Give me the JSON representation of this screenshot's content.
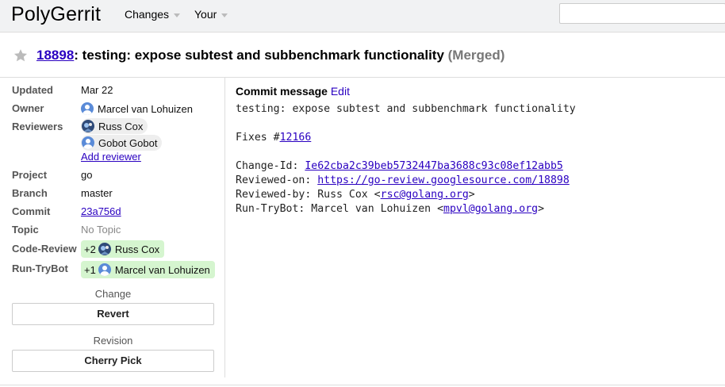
{
  "header": {
    "brand": "PolyGerrit",
    "nav": [
      "Changes",
      "Your"
    ],
    "search": {
      "value": "",
      "placeholder": ""
    }
  },
  "change": {
    "number": "18898",
    "title": ": testing: expose subtest and subbenchmark functionality ",
    "status": "(Merged)"
  },
  "info": {
    "updated_label": "Updated",
    "updated": "Mar 22",
    "owner_label": "Owner",
    "owner": "Marcel van Lohuizen",
    "reviewers_label": "Reviewers",
    "reviewer1": "Russ Cox",
    "reviewer2": "Gobot Gobot",
    "add_reviewer": "Add reviewer",
    "project_label": "Project",
    "project": "go",
    "branch_label": "Branch",
    "branch": "master",
    "commit_label": "Commit",
    "commit": "23a756d",
    "topic_label": "Topic",
    "topic": "No Topic",
    "code_review_label": "Code-Review",
    "code_review_vote": "+2",
    "code_review_user": "Russ Cox",
    "run_trybot_label": "Run-TryBot",
    "run_trybot_vote": "+1",
    "run_trybot_user": "Marcel van Lohuizen"
  },
  "actions": {
    "change_title": "Change",
    "revert": "Revert",
    "revision_title": "Revision",
    "cherry_pick": "Cherry Pick"
  },
  "commit_message": {
    "heading": "Commit message",
    "edit": "Edit",
    "subject": "testing: expose subtest and subbenchmark functionality",
    "fixes_prefix": "Fixes #",
    "fixes_num": "12166",
    "change_id_prefix": "Change-Id: ",
    "change_id": "Ie62cba2c39beb5732447ba3688c93c08ef12abb5",
    "reviewed_on_prefix": "Reviewed-on: ",
    "reviewed_on": "https://go-review.googlesource.com/18898",
    "reviewed_by_prefix": "Reviewed-by: Russ Cox <",
    "reviewed_by_email": "rsc@golang.org",
    "reviewed_by_suffix": ">",
    "trybot_prefix": "Run-TryBot: Marcel van Lohuizen <",
    "trybot_email": "mpvl@golang.org",
    "trybot_suffix": ">"
  },
  "colors": {
    "link": "#2a00c1",
    "vote_bg": "#d5f5cf",
    "header_bg": "#f1f2f3"
  }
}
